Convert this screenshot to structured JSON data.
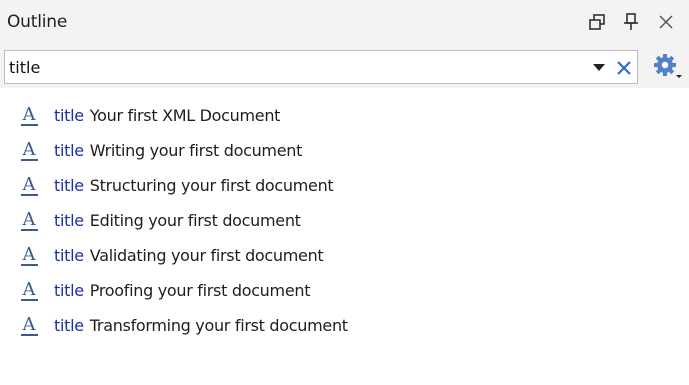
{
  "panel": {
    "title": "Outline",
    "buttons": {
      "restore": "restore-icon",
      "pin": "pin-icon",
      "close": "close-icon"
    }
  },
  "filter": {
    "value": "title",
    "dropdown_icon": "dropdown-arrow-icon",
    "clear_icon": "clear-x-icon",
    "settings_icon": "gear-icon"
  },
  "items": [
    {
      "tag": "title",
      "text": "Your first XML Document"
    },
    {
      "tag": "title",
      "text": "Writing your first document"
    },
    {
      "tag": "title",
      "text": "Structuring your first document"
    },
    {
      "tag": "title",
      "text": "Editing your first document"
    },
    {
      "tag": "title",
      "text": "Validating your first document"
    },
    {
      "tag": "title",
      "text": "Proofing your first document"
    },
    {
      "tag": "title",
      "text": "Transforming your first document"
    }
  ],
  "colors": {
    "tag": "#1b2fa8",
    "icon": "#3a5b8c",
    "clear": "#2f6fc9",
    "header_bg": "#f3f3f3"
  }
}
